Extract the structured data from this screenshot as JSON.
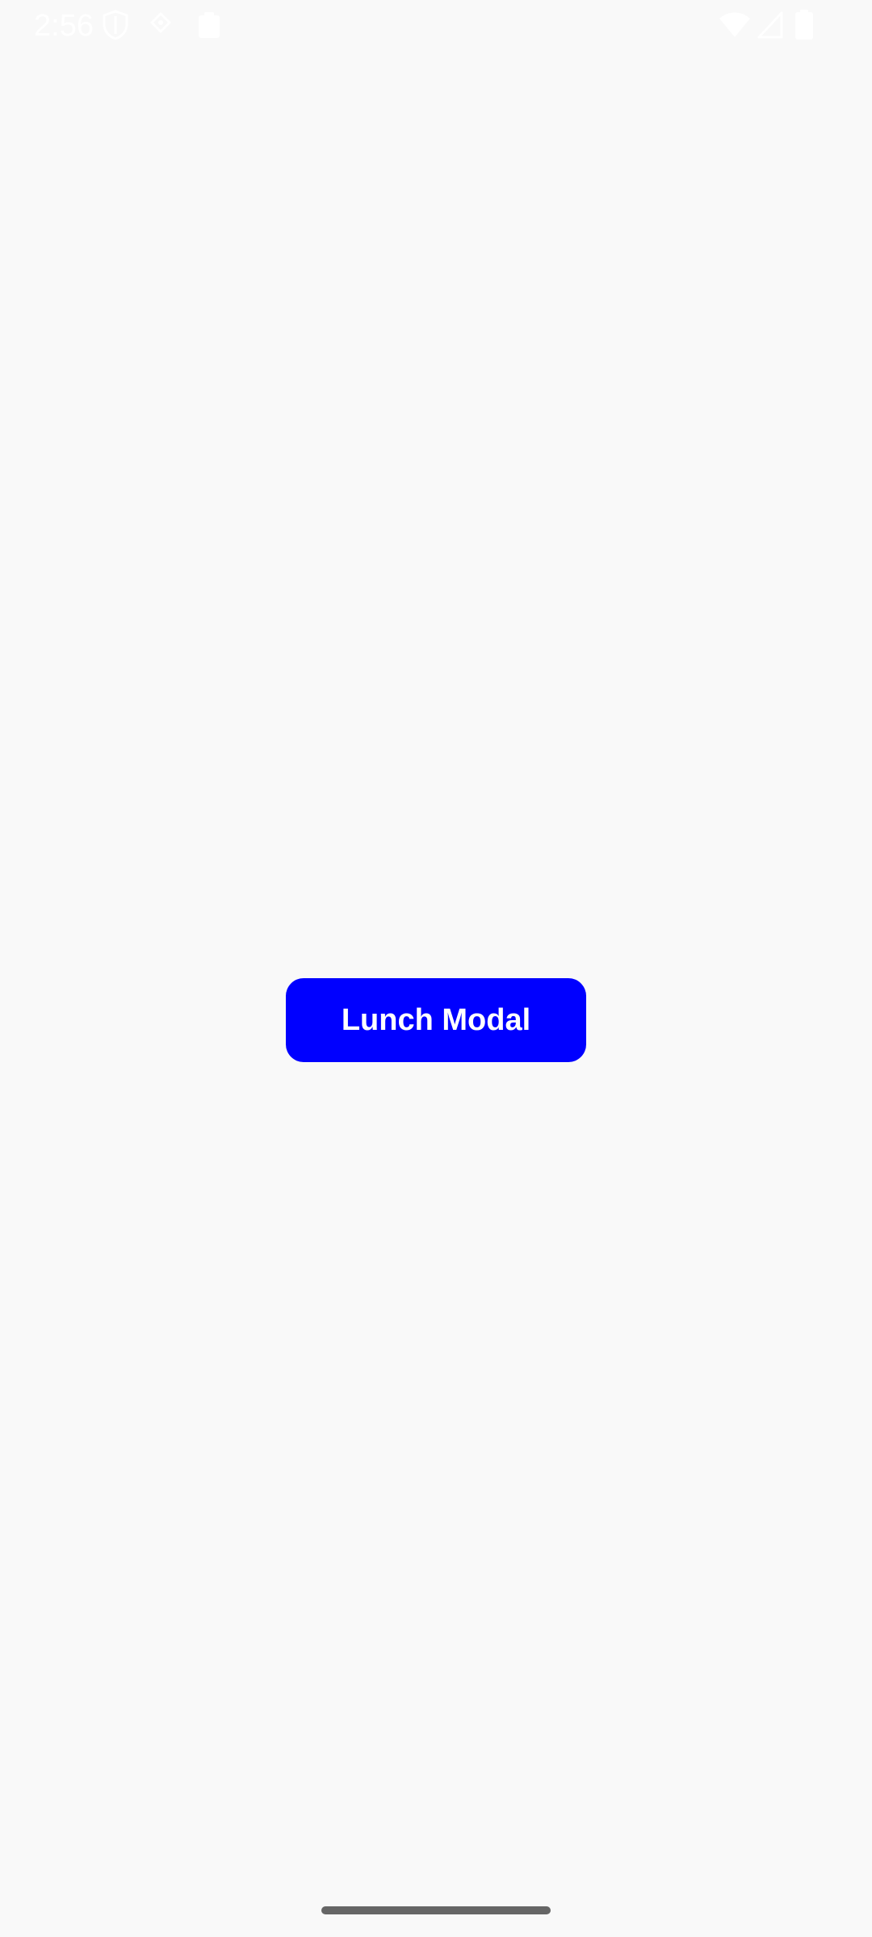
{
  "status_bar": {
    "time": "2:56",
    "left_icons": [
      "shield-icon",
      "notification-icon",
      "clipboard-icon"
    ],
    "right_icons": [
      "wifi-icon",
      "signal-icon",
      "battery-icon"
    ],
    "icon_color": "#ffffff"
  },
  "main": {
    "background_color": "#f9f9f9",
    "launch_button": {
      "label": "Lunch Modal",
      "background_color": "#0000ff",
      "text_color": "#ffffff"
    }
  },
  "navigation": {
    "home_indicator_color": "#666666"
  }
}
